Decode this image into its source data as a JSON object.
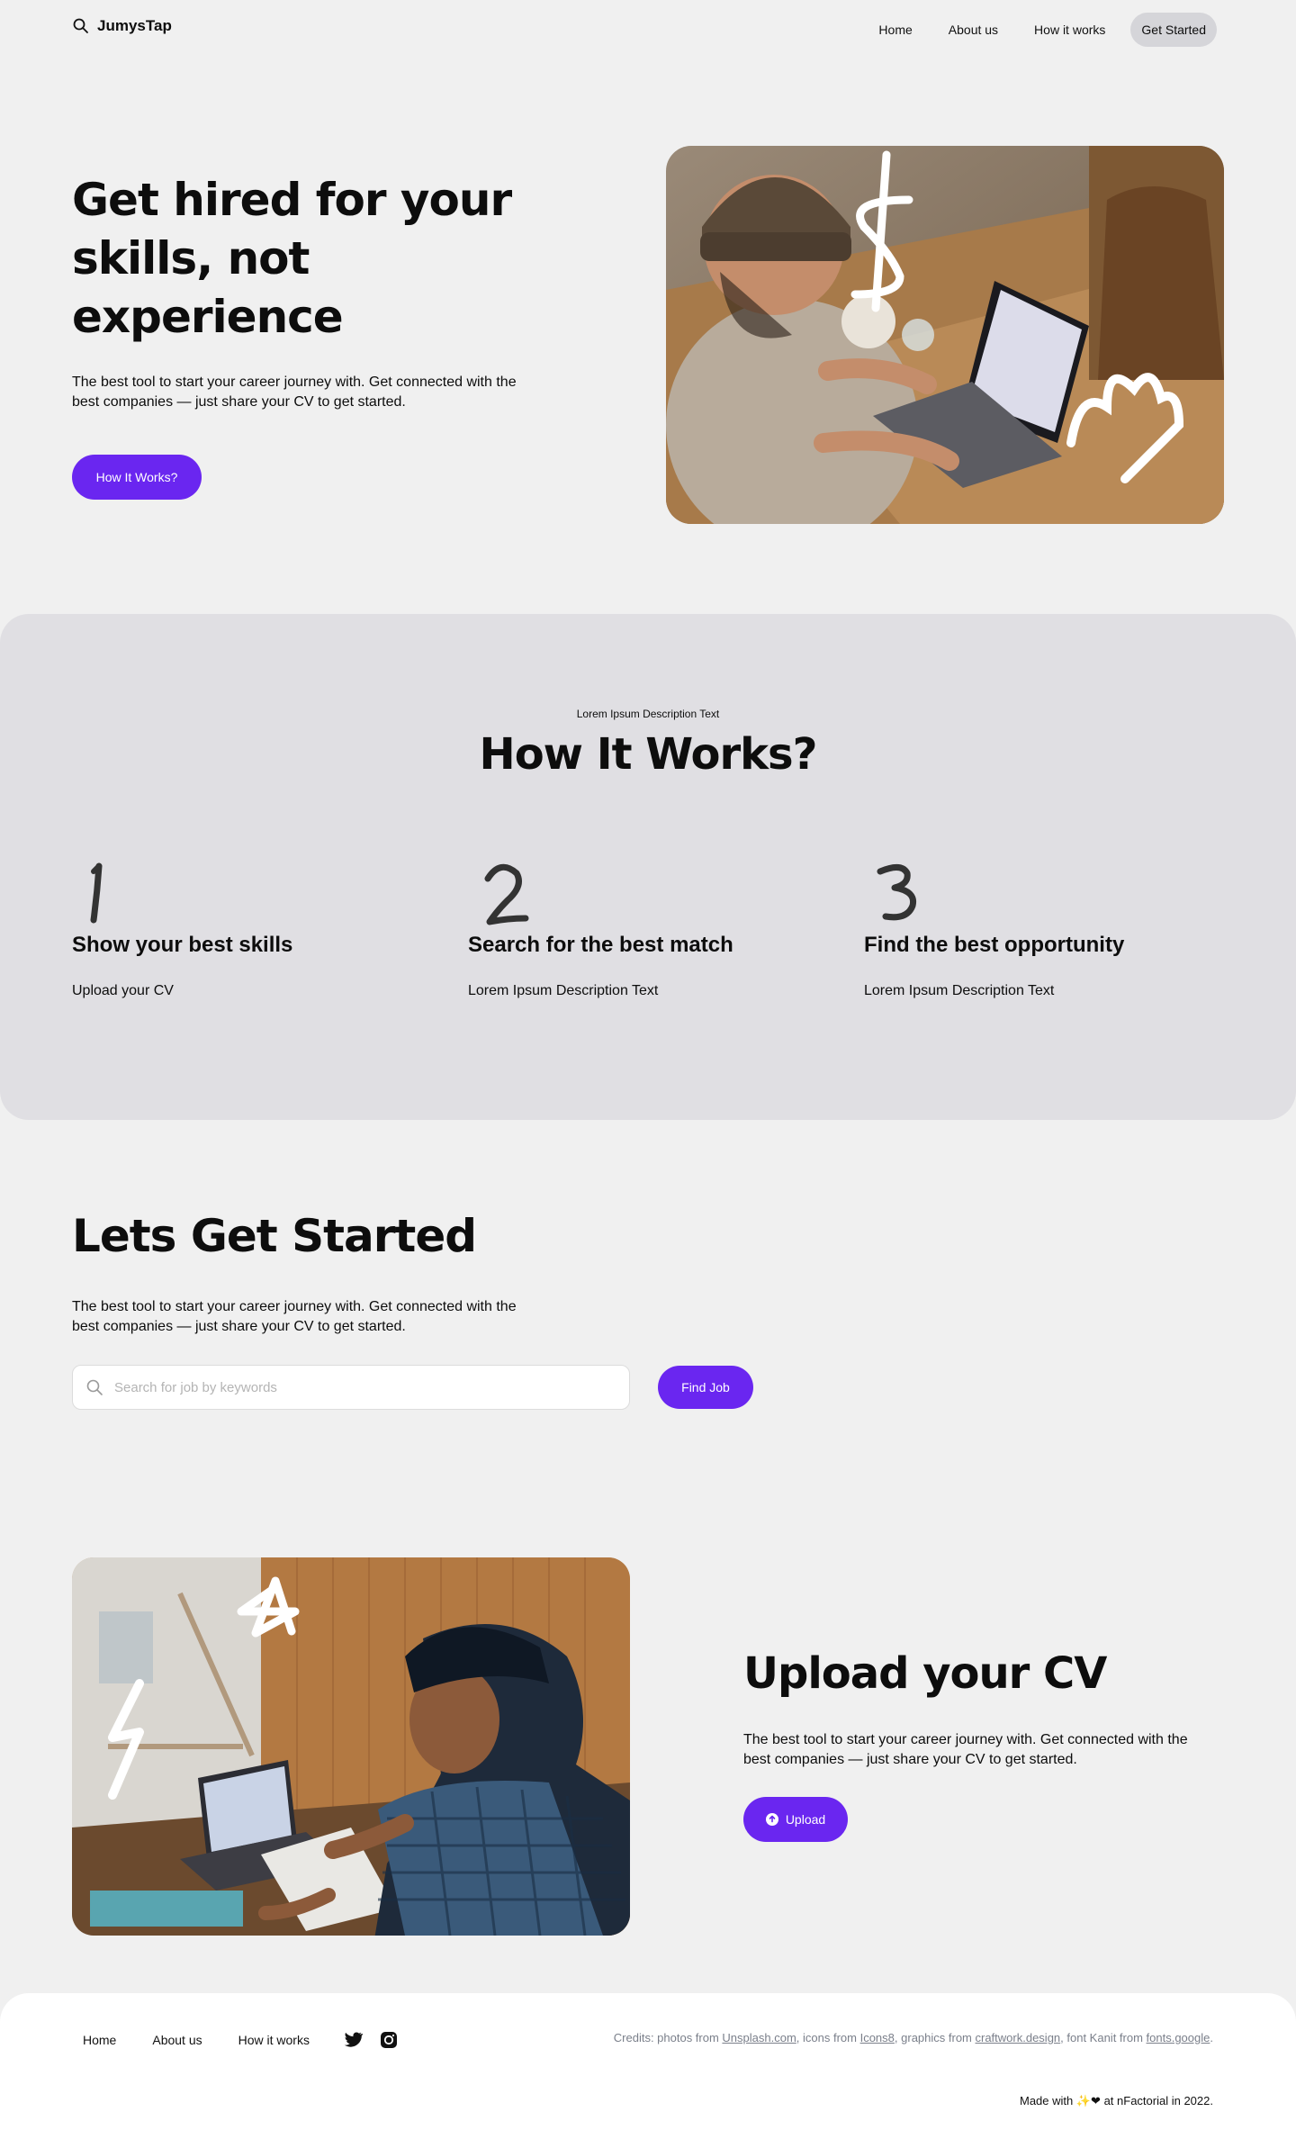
{
  "brand": {
    "name": "JumysTap",
    "icon": "magnifier-logo-icon"
  },
  "nav": {
    "links": [
      "Home",
      "About us",
      "How it works"
    ],
    "cta": "Get Started"
  },
  "hero": {
    "title": "Get hired for your skills, not experience",
    "description": "The best tool to start your career journey with. Get connected with the best companies — just share your CV to get started.",
    "button": "How It Works?"
  },
  "how_it_works": {
    "eyebrow": "Lorem Ipsum Description Text",
    "title": "How It Works?",
    "steps": [
      {
        "number": "1",
        "title": "Show your best skills",
        "description": "Upload your CV"
      },
      {
        "number": "2",
        "title": "Search for the best match",
        "description": "Lorem Ipsum Description Text"
      },
      {
        "number": "3",
        "title": "Find the best opportunity",
        "description": "Lorem Ipsum Description Text"
      }
    ]
  },
  "get_started": {
    "title": "Lets Get Started",
    "description": "The best tool to start your career journey with. Get connected with the best companies — just share your CV to get started.",
    "search_placeholder": "Search for job by keywords",
    "search_value": "",
    "button": "Find Job"
  },
  "upload_cv": {
    "title": "Upload your CV",
    "description": "The best tool to start your career journey with. Get connected with the best companies — just share your CV to get started.",
    "button": "Upload"
  },
  "footer": {
    "links": [
      "Home",
      "About us",
      "How it works"
    ],
    "social": [
      "twitter-icon",
      "instagram-icon"
    ],
    "credits": {
      "prefix": "Credits: photos from ",
      "unsplash": "Unsplash.com",
      "sep1": ", icons from ",
      "icons8": "Icons8",
      "sep2": ", graphics from ",
      "craftwork": "craftwork.design",
      "sep3": ", font Kanit from ",
      "fonts": "fonts.google",
      "suffix": "."
    },
    "made_with": {
      "prefix": "Made with ",
      "icons": "✨❤",
      "suffix": " at nFactorial in 2022."
    }
  },
  "colors": {
    "accent": "#6a26f0",
    "section_bg": "#e0dfe3",
    "page_bg": "#f0f0f0"
  }
}
